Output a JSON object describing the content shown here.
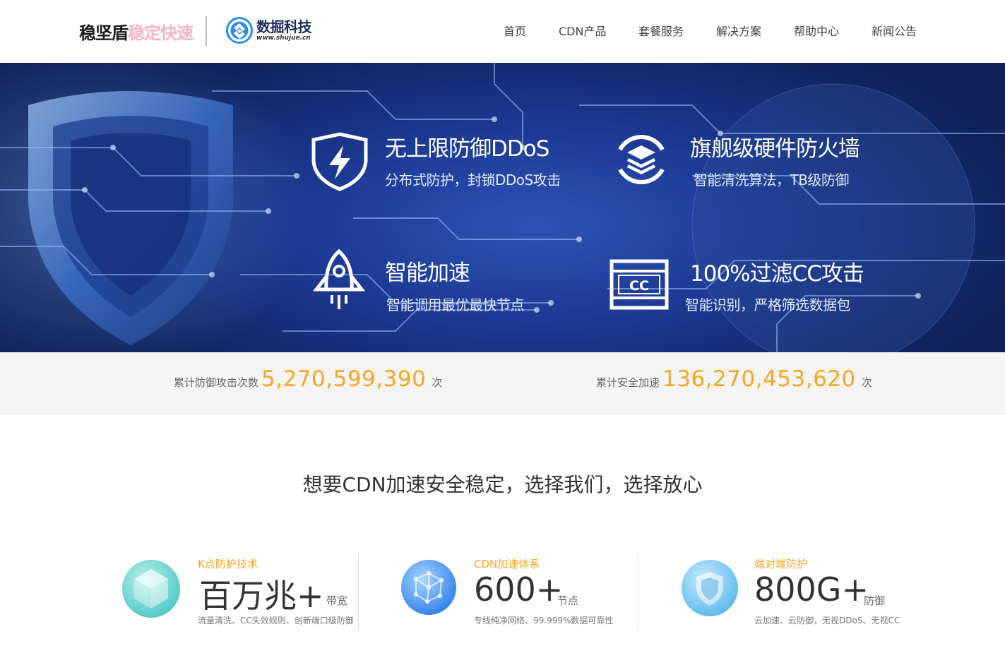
{
  "header": {
    "brand_main": "稳坚盾",
    "brand_slogan": "稳定快速",
    "partner_name": "数掘科技",
    "partner_url": "www.shujue.cn"
  },
  "nav": [
    {
      "label": "首页"
    },
    {
      "label": "CDN产品"
    },
    {
      "label": "套餐服务"
    },
    {
      "label": "解决方案"
    },
    {
      "label": "帮助中心"
    },
    {
      "label": "新闻公告"
    }
  ],
  "hero": {
    "features": [
      {
        "title": "无上限防御DDoS",
        "subtitle": "分布式防护，封锁DDoS攻击",
        "icon": "shield-bolt-icon"
      },
      {
        "title": "旗舰级硬件防火墙",
        "subtitle": "智能清洗算法，TB级防御",
        "icon": "layers-icon"
      },
      {
        "title": "智能加速",
        "subtitle": "智能调用最优最快节点",
        "icon": "rocket-icon"
      },
      {
        "title": "100%过滤CC攻击",
        "subtitle": "智能识别，严格筛选数据包",
        "icon": "cc-icon"
      }
    ]
  },
  "stats": [
    {
      "label": "累计防御攻击次数",
      "value": "5,270,599,390",
      "unit": "次"
    },
    {
      "label": "累计安全加速",
      "value": "136,270,453,620",
      "unit": "次"
    }
  ],
  "section": {
    "title": "想要CDN加速安全稳定，选择我们，选择放心"
  },
  "cards": [
    {
      "category": "K点防护技术",
      "value": "百万兆+",
      "unit": "带宽",
      "desc": "流量清洗、CC失效规则、创新端口级防御",
      "icon": "crystal-icon"
    },
    {
      "category": "CDN加速体系",
      "value": "600+",
      "unit": "节点",
      "desc": "专线纯净网络、99.999%数据可靠性",
      "icon": "network-sphere-icon"
    },
    {
      "category": "端对端防护",
      "value": "800G+",
      "unit": "防御",
      "desc": "云加速、云防御，无视DDoS、无视CC",
      "icon": "shield-icon"
    }
  ],
  "colors": {
    "accent": "#f5a623",
    "hero_bg": "#1d3a94",
    "brand_pink": "#f3b6c2"
  }
}
